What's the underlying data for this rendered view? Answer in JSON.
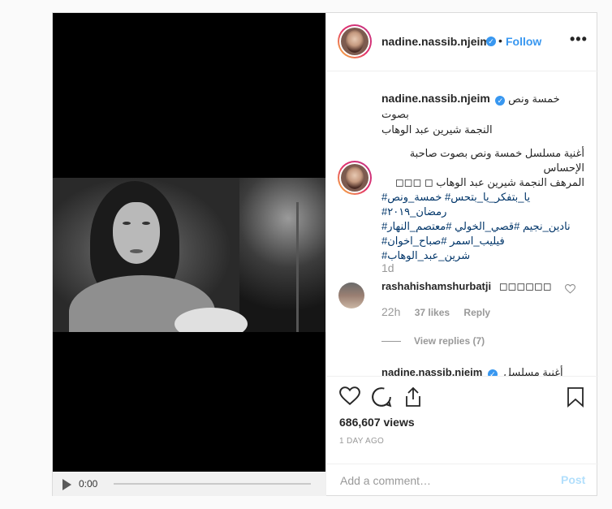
{
  "video": {
    "time": "0:00",
    "icons": {
      "play": "play-icon"
    }
  },
  "header": {
    "username": "nadine.nassib.njeim",
    "separator": "•",
    "follow_label": "Follow",
    "more_label": "•••"
  },
  "caption": {
    "username": "nadine.nassib.njeim",
    "title_line1": "خمسة ونص بصوت",
    "title_line2": "النجمة شيرين عبد الوهاب",
    "body_line1": "أغنية مسلسل خمسة ونص بصوت صاحبة الإحساس",
    "body_line2": "المرهف النجمة شيرين عبد الوهاب ◻ ◻◻◻",
    "tags_line1": "يا_بتفكر_يا_بتحس# خمسة_ونص#",
    "tags_line2": "رمضان_٢٠١٩#",
    "tags_line3": "نادين_نجيم #قصي_الخولي #معتصم_النهار#",
    "tags_line4": "فيليب_اسمر #صباح_اخوان#",
    "tags_line5": "شرين_عبد_الوهاب#",
    "age": "1d"
  },
  "comments": [
    {
      "username": "rashahishamshurbatji",
      "text": "◻◻◻◻◻◻",
      "age": "22h",
      "likes": "37 likes",
      "reply_label": "Reply",
      "view_replies": "View replies (7)"
    },
    {
      "username": "nadine.nassib.njeim",
      "text": "أغنية مسلسل"
    }
  ],
  "actions": {
    "views": "686,607 views",
    "date": "1 DAY AGO"
  },
  "add_comment": {
    "placeholder": "Add a comment…",
    "post_label": "Post"
  },
  "colors": {
    "accent": "#3897f0",
    "post_disabled": "#b2dffc",
    "muted": "#999999",
    "hashtag": "#003569"
  }
}
